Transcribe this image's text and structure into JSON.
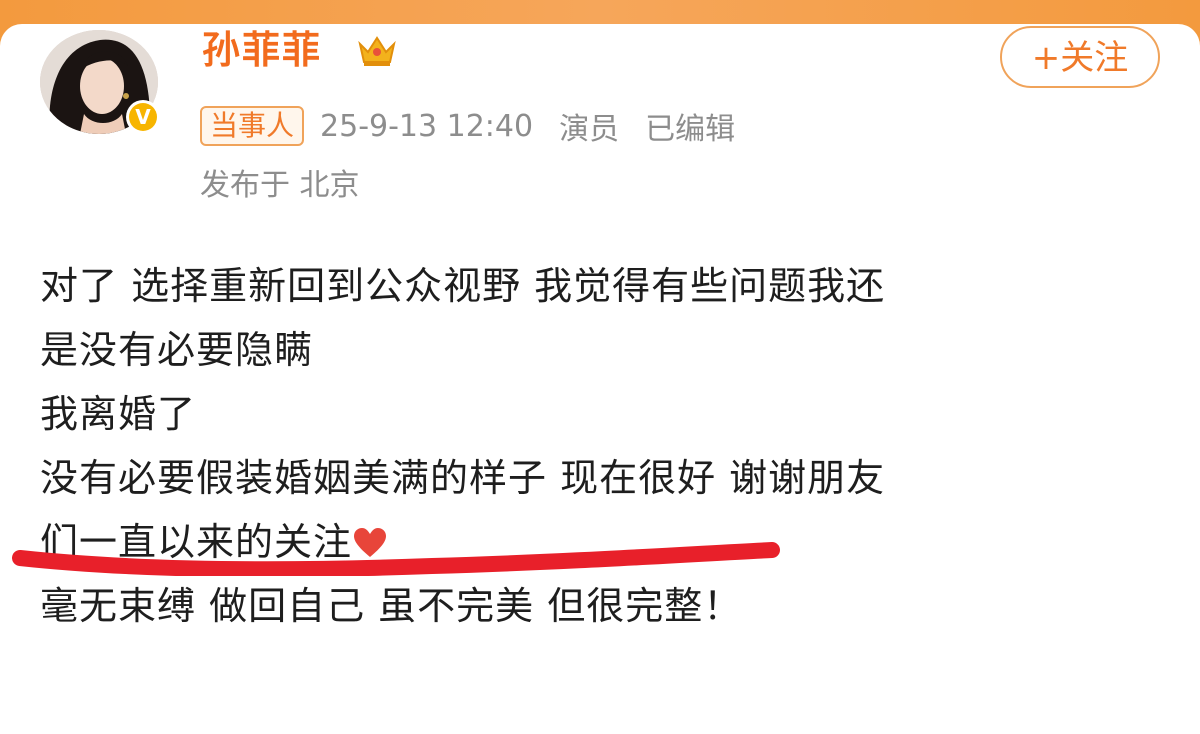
{
  "profile": {
    "username": "孙菲菲",
    "avatar_icon": "portrait-avatar",
    "verified_icon": "verified-badge-icon",
    "crown_icon": "crown-icon",
    "follow_label": "+关注"
  },
  "meta": {
    "tag": "当事人",
    "timestamp": "25-9-13 12:40",
    "role": "演员",
    "edited": "已编辑",
    "location": "发布于 北京"
  },
  "post": {
    "lines": [
      "对了 选择重新回到公众视野 我觉得有些问题我还",
      "是没有必要隐瞒",
      "我离婚了",
      "没有必要假装婚姻美满的样子 现在很好 谢谢朋友",
      "们一直以来的关注",
      "毫无束缚 做回自己 虽不完美 但很完整！"
    ]
  },
  "colors": {
    "accent": "#f26b1d",
    "top_band": "#f39a3c",
    "underline": "#e8202a",
    "meta_text": "#8d8d8d"
  }
}
